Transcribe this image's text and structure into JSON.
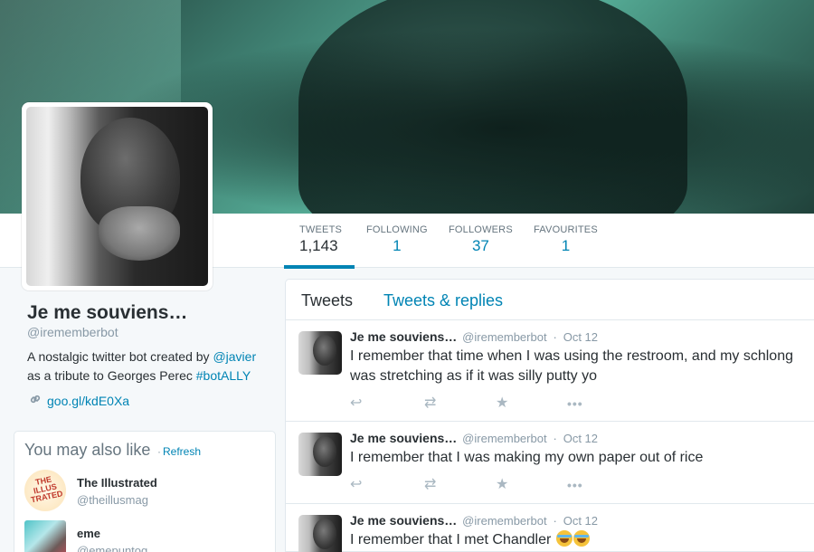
{
  "profile": {
    "name": "Je me souviens…",
    "handle": "@irememberbot",
    "bio_prefix": "A nostalgic twitter bot created by ",
    "bio_mention": "@javier",
    "bio_middle": "as a tribute to Georges Perec ",
    "bio_hashtag": "#botALLY",
    "link": "goo.gl/kdE0Xa",
    "link_icon": "link-icon"
  },
  "stats": [
    {
      "label": "TWEETS",
      "value": "1,143"
    },
    {
      "label": "FOLLOWING",
      "value": "1"
    },
    {
      "label": "FOLLOWERS",
      "value": "37"
    },
    {
      "label": "FAVOURITES",
      "value": "1"
    }
  ],
  "timeline": {
    "tabs": [
      "Tweets",
      "Tweets & replies"
    ],
    "tweets": [
      {
        "name": "Je me souviens…",
        "handle": "@irememberbot",
        "sep": "·",
        "time": "Oct 12",
        "text": "I remember that time when I was using the restroom, and my schlong was stretching as if it was silly putty yo"
      },
      {
        "name": "Je me souviens…",
        "handle": "@irememberbot",
        "sep": "·",
        "time": "Oct 12",
        "text": "I remember that I was making my own paper out of rice"
      },
      {
        "name": "Je me souviens…",
        "handle": "@irememberbot",
        "sep": "·",
        "time": "Oct 12",
        "text": "I remember that I met Chandler "
      }
    ],
    "actions": {
      "reply": "↩",
      "retweet": "⇄",
      "favourite": "★",
      "more": "•••"
    }
  },
  "who_to_follow": {
    "title": "You may also like",
    "dot": "·",
    "refresh": "Refresh",
    "users": [
      {
        "name": "The Illustrated",
        "handle": "@theillusmag",
        "logo_text": "THE ILLUS TRATED"
      },
      {
        "name": "eme",
        "handle": "@emepuntog"
      }
    ]
  },
  "colors": {
    "accent": "#0084b4",
    "banner_teal": "#5ab59e",
    "text": "#292f33",
    "muted": "#8899a6"
  }
}
